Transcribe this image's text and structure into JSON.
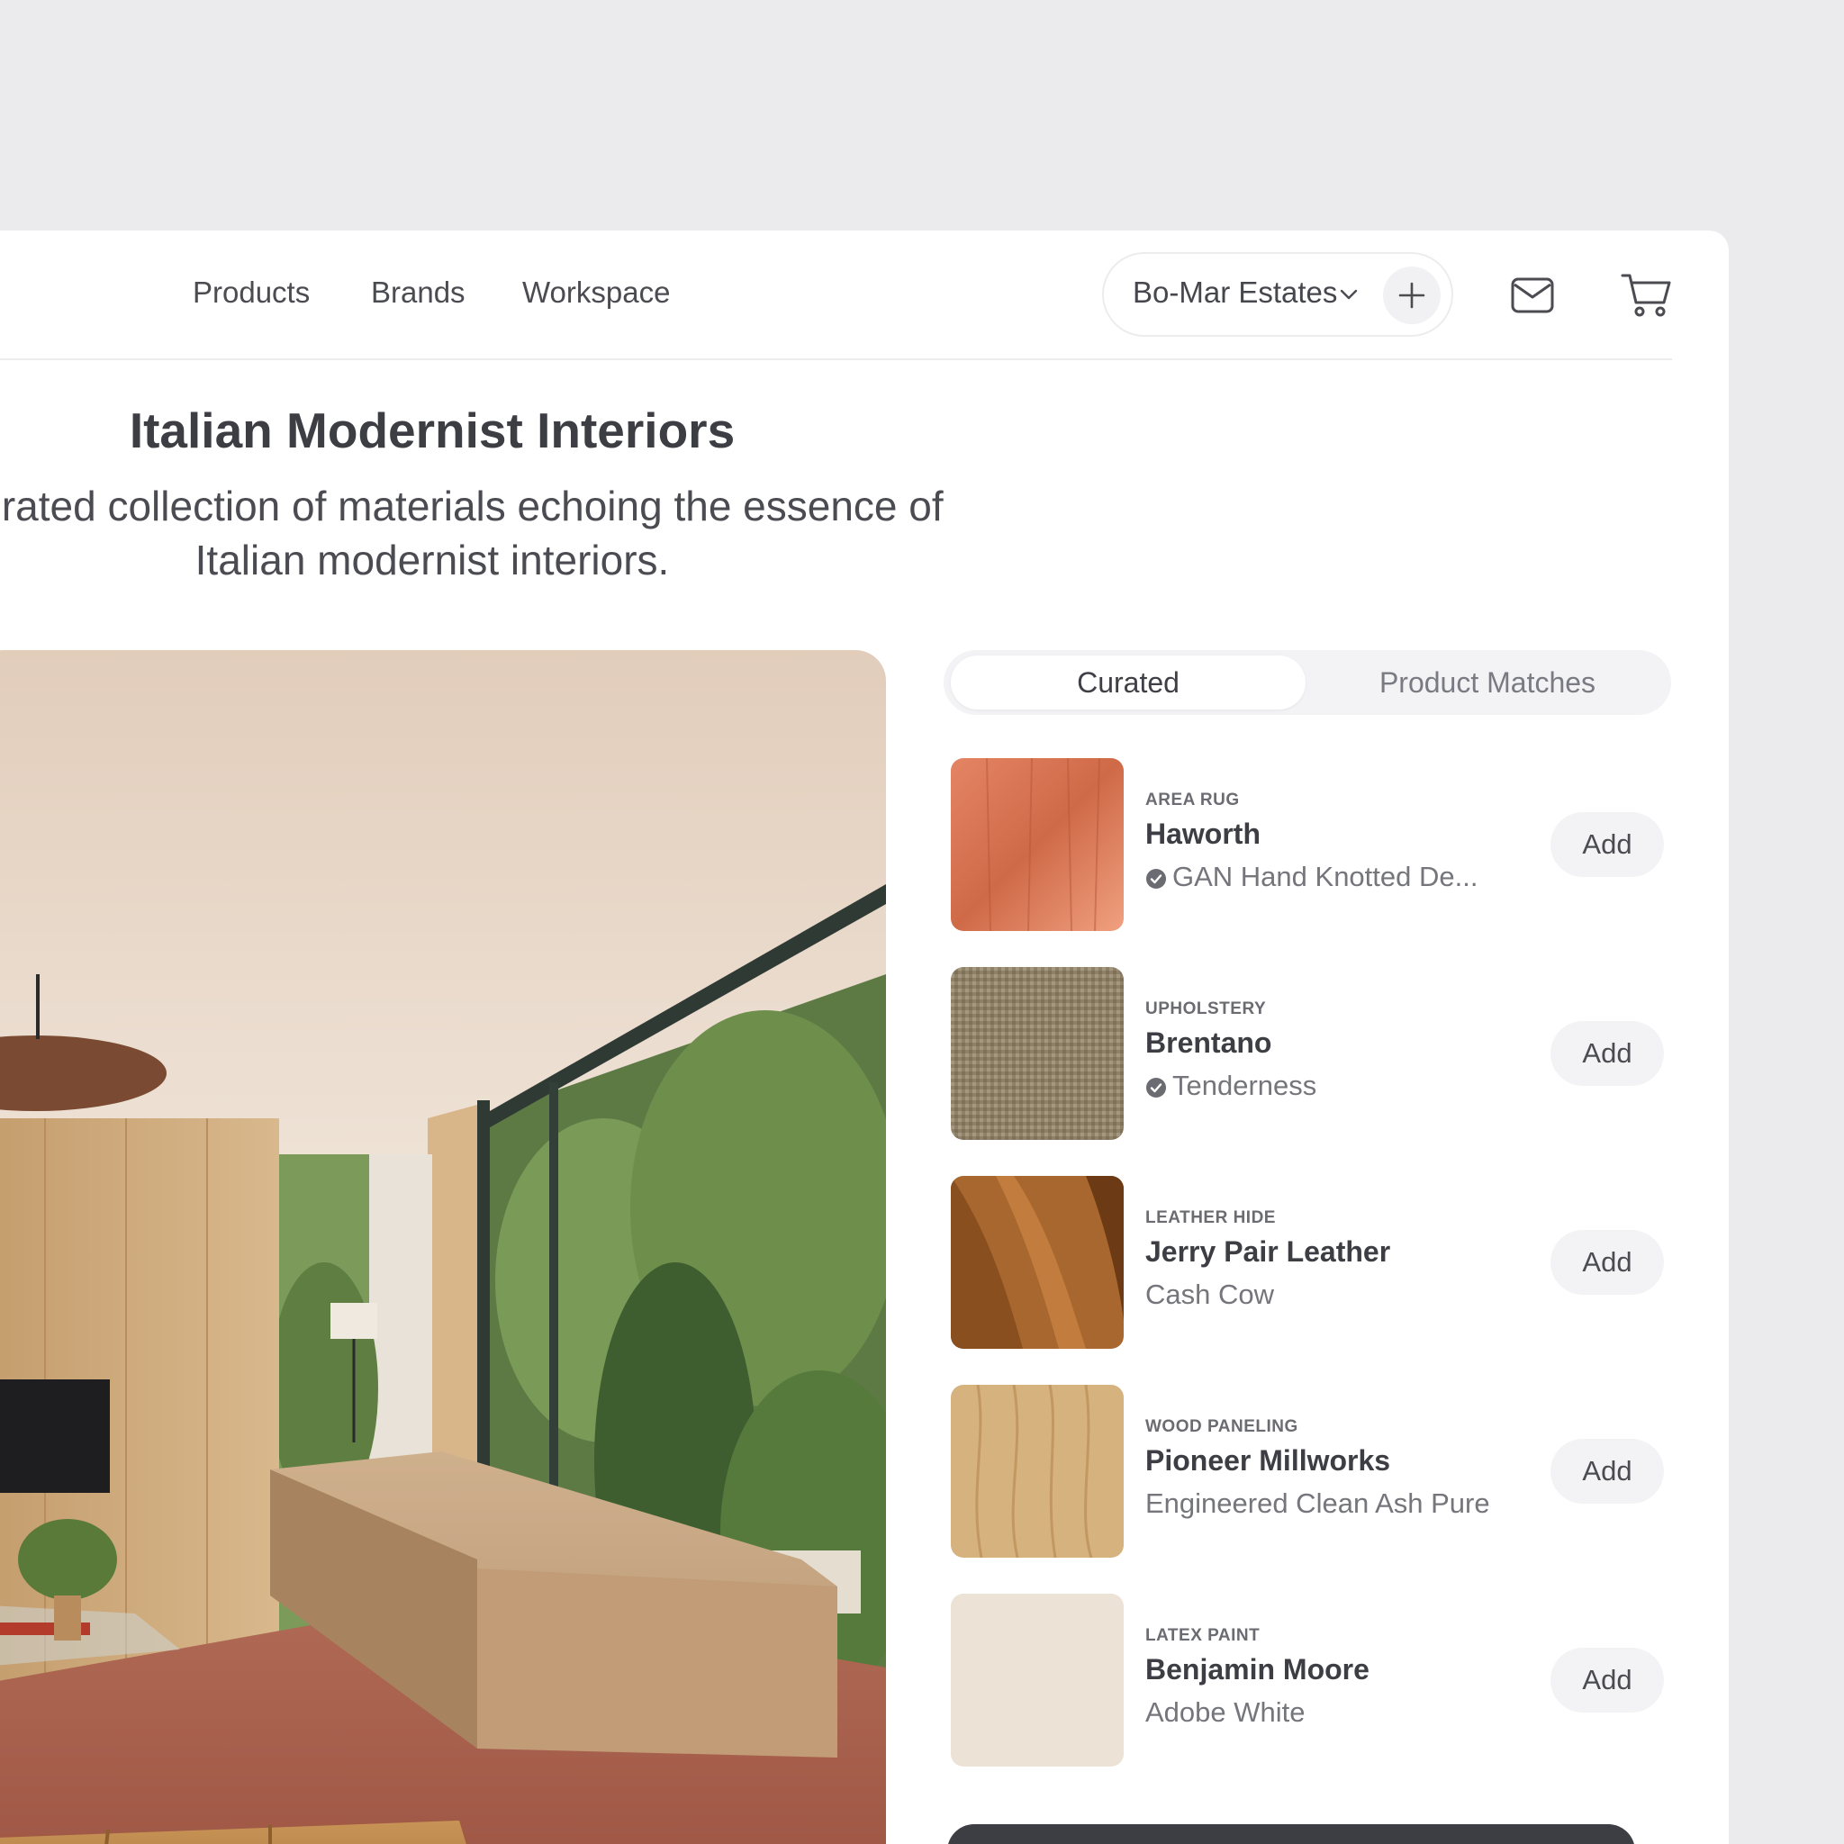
{
  "nav": {
    "links": [
      "Products",
      "Brands",
      "Workspace"
    ],
    "project": "Bo-Mar Estates",
    "icons": {
      "dropdown": "chevron-down-icon",
      "add": "plus-icon",
      "mail": "mail-icon",
      "cart": "cart-icon"
    }
  },
  "page": {
    "title": "Italian Modernist Interiors",
    "description": "A curated collection of materials echoing the essence of Italian modernist interiors."
  },
  "tabs": {
    "active": "Curated",
    "inactive": "Product Matches"
  },
  "materials": [
    {
      "category": "AREA RUG",
      "brand": "Haworth",
      "product": "GAN Hand Knotted De...",
      "verified": true,
      "add_label": "Add"
    },
    {
      "category": "UPHOLSTERY",
      "brand": "Brentano",
      "product": "Tenderness",
      "verified": true,
      "add_label": "Add"
    },
    {
      "category": "LEATHER HIDE",
      "brand": "Jerry Pair Leather",
      "product": "Cash Cow",
      "verified": false,
      "add_label": "Add"
    },
    {
      "category": "WOOD PANELING",
      "brand": "Pioneer Millworks",
      "product": "Engineered Clean Ash Pure",
      "verified": false,
      "add_label": "Add"
    },
    {
      "category": "LATEX PAINT",
      "brand": "Benjamin Moore",
      "product": "Adobe White",
      "verified": false,
      "add_label": "Add"
    }
  ],
  "colors": {
    "background": "#ebebed",
    "panel": "#ffffff",
    "text": "#3d3d44",
    "button": "#f3f3f5"
  }
}
